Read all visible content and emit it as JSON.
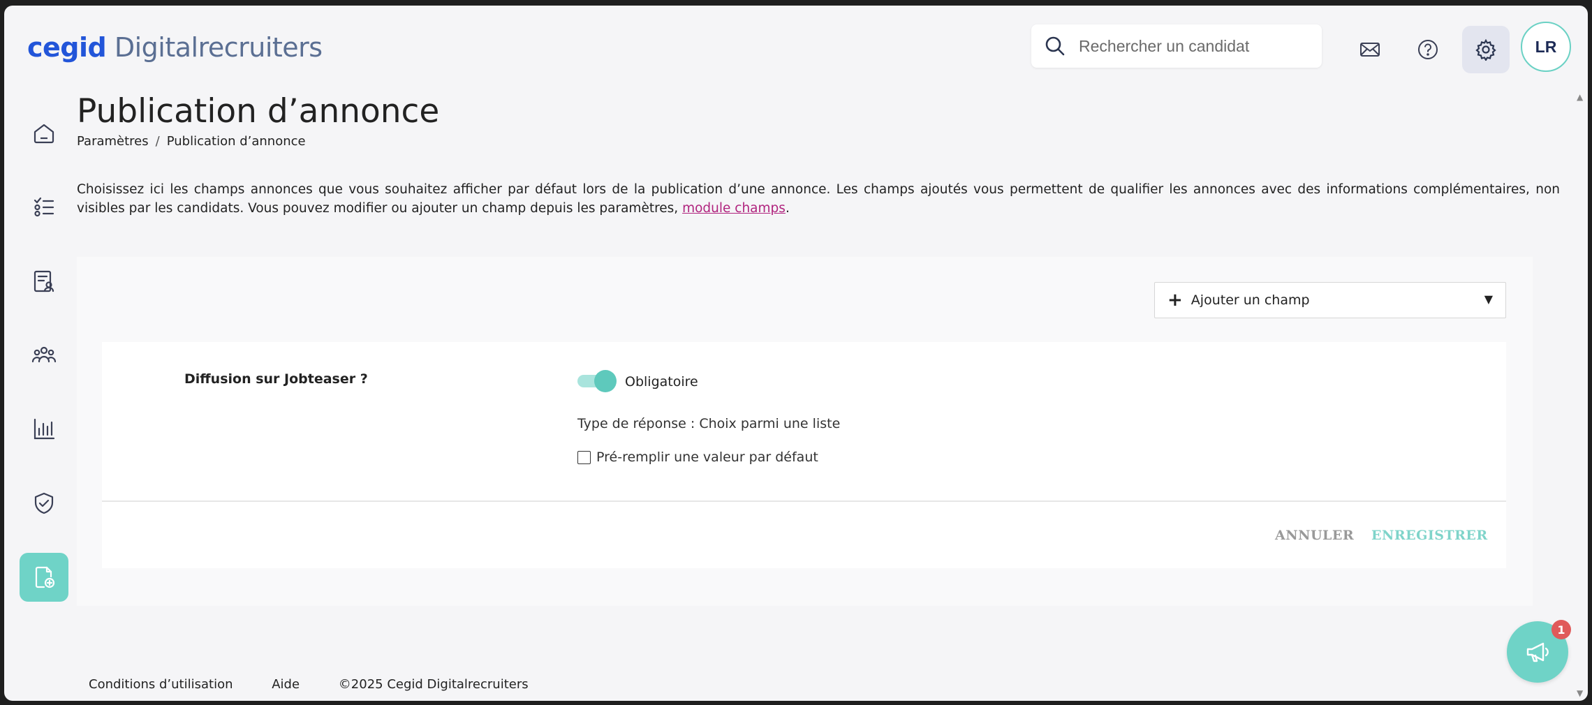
{
  "header": {
    "logo_brand": "cegid",
    "logo_product": "Digitalrecruiters",
    "search_placeholder": "Rechercher un candidat",
    "avatar_initials": "LR"
  },
  "page": {
    "title": "Publication d’annonce",
    "breadcrumb": [
      "Paramètres",
      "Publication d’annonce"
    ],
    "intro_text": "Choisissez ici les champs annonces que vous souhaitez afficher par défaut lors de la publication d’une annonce. Les champs ajoutés vous permettent de qualifier les annonces avec des informations complémentaires, non visibles par les candidats. Vous pouvez modifier ou ajouter un champ depuis les paramètres, ",
    "intro_link": "module champs",
    "intro_end": "."
  },
  "panel": {
    "add_field_label": "Ajouter un champ",
    "field": {
      "label": "Diffusion sur Jobteaser ?",
      "toggle_label": "Obligatoire",
      "type_line": "Type de réponse : Choix parmi une liste",
      "prefill_label": "Pré-remplir une valeur par défaut"
    },
    "cancel_label": "ANNULER",
    "save_label": "ENREGISTRER"
  },
  "footer": {
    "terms": "Conditions d’utilisation",
    "help": "Aide",
    "copyright": "©2025 Cegid Digitalrecruiters"
  },
  "notifications": {
    "badge_count": "1"
  },
  "colors": {
    "brand_blue": "#2255d9",
    "accent_teal": "#6fd3c7",
    "link_magenta": "#b0237e",
    "badge_red": "#e05a5a"
  },
  "icons": {
    "header": [
      "mail-icon",
      "help-icon",
      "gear-icon"
    ],
    "sidebar": [
      "home-icon",
      "checklist-icon",
      "candidate-file-icon",
      "team-icon",
      "analytics-icon",
      "shield-icon",
      "add-document-icon"
    ]
  }
}
